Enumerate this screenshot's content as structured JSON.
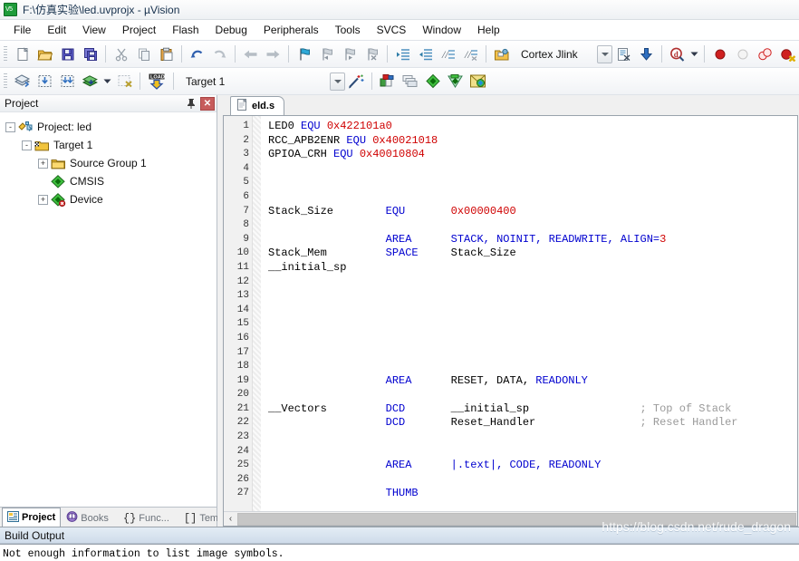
{
  "window": {
    "title": "F:\\仿真实验\\led.uvprojx - µVision",
    "app_icon": "uvision-v5-icon"
  },
  "menubar": {
    "items": [
      "File",
      "Edit",
      "View",
      "Project",
      "Flash",
      "Debug",
      "Peripherals",
      "Tools",
      "SVCS",
      "Window",
      "Help"
    ]
  },
  "toolbar_main": {
    "buttons": [
      {
        "name": "new-file-icon",
        "title": "New"
      },
      {
        "name": "open-file-icon",
        "title": "Open"
      },
      {
        "name": "save-icon",
        "title": "Save"
      },
      {
        "name": "save-all-icon",
        "title": "Save All"
      },
      {
        "name": "cut-icon",
        "title": "Cut"
      },
      {
        "name": "copy-icon",
        "title": "Copy"
      },
      {
        "name": "paste-icon",
        "title": "Paste"
      },
      {
        "name": "undo-icon",
        "title": "Undo"
      },
      {
        "name": "redo-icon",
        "title": "Redo"
      },
      {
        "name": "navigate-back-icon",
        "title": "Back"
      },
      {
        "name": "navigate-forward-icon",
        "title": "Forward"
      },
      {
        "name": "bookmark-toggle-icon",
        "title": "Insert/Remove Bookmark"
      },
      {
        "name": "bookmark-prev-icon",
        "title": "Previous Bookmark"
      },
      {
        "name": "bookmark-next-icon",
        "title": "Next Bookmark"
      },
      {
        "name": "bookmark-clear-icon",
        "title": "Clear All Bookmarks"
      },
      {
        "name": "indent-increase-icon",
        "title": "Indent"
      },
      {
        "name": "indent-decrease-icon",
        "title": "Outdent"
      },
      {
        "name": "comment-icon",
        "title": "Comment"
      },
      {
        "name": "uncomment-icon",
        "title": "Uncomment"
      },
      {
        "name": "target-options-icon",
        "title": "Options for Target"
      }
    ],
    "debugger_combo": {
      "value": "Cortex Jlink"
    },
    "right_buttons": [
      {
        "name": "configure-flash-tools-icon"
      },
      {
        "name": "download-to-flash-icon"
      },
      {
        "name": "start-debug-session-icon"
      },
      {
        "name": "insert-breakpoint-icon"
      },
      {
        "name": "disable-breakpoint-icon"
      },
      {
        "name": "disable-all-breakpoints-icon"
      },
      {
        "name": "kill-all-breakpoints-icon"
      }
    ]
  },
  "toolbar_build": {
    "buttons": [
      {
        "name": "translate-icon",
        "title": "Translate"
      },
      {
        "name": "build-icon",
        "title": "Build"
      },
      {
        "name": "rebuild-icon",
        "title": "Rebuild"
      },
      {
        "name": "batch-build-icon",
        "title": "Batch Build"
      },
      {
        "name": "stop-build-icon",
        "title": "Stop Build"
      },
      {
        "name": "load-icon",
        "title": "Download"
      }
    ],
    "target_combo": {
      "value": "Target 1"
    },
    "right_buttons": [
      {
        "name": "target-options-wand-icon"
      },
      {
        "name": "manage-project-items-icon"
      },
      {
        "name": "multi-project-icon"
      },
      {
        "name": "pack-installer-icon"
      },
      {
        "name": "manage-run-time-env-icon"
      },
      {
        "name": "select-software-packs-icon"
      }
    ]
  },
  "project_panel": {
    "title": "Project",
    "pin_icon": "pin-icon",
    "close_icon": "close-icon",
    "tree": [
      {
        "label": "Project: led",
        "icon": "project-icon",
        "depth": 0,
        "expander": "-"
      },
      {
        "label": "Target 1",
        "icon": "target-folder-icon",
        "depth": 1,
        "expander": "-"
      },
      {
        "label": "Source Group 1",
        "icon": "folder-icon",
        "depth": 2,
        "expander": "+"
      },
      {
        "label": "CMSIS",
        "icon": "component-icon",
        "depth": 2,
        "expander": ""
      },
      {
        "label": "Device",
        "icon": "component-warn-icon",
        "depth": 2,
        "expander": "+"
      }
    ]
  },
  "panel_tabs": [
    {
      "label": "Project",
      "icon": "project-tab-icon",
      "active": true
    },
    {
      "label": "Books",
      "icon": "books-tab-icon",
      "active": false
    },
    {
      "label": "Func...",
      "icon": "functions-tab-icon",
      "active": false
    },
    {
      "label": "Temp...",
      "icon": "templates-tab-icon",
      "active": false
    }
  ],
  "editor": {
    "tabs": [
      {
        "label": "eld.s",
        "icon": "source-file-icon",
        "active": true
      }
    ],
    "first_line": 1,
    "lines": [
      {
        "n": 1,
        "tokens": [
          {
            "t": "LED0 ",
            "c": ""
          },
          {
            "t": "EQU",
            "c": "kw"
          },
          {
            "t": " ",
            "c": ""
          },
          {
            "t": "0x422101a0",
            "c": "num"
          }
        ]
      },
      {
        "n": 2,
        "tokens": [
          {
            "t": "RCC_APB2ENR ",
            "c": ""
          },
          {
            "t": "EQU",
            "c": "kw"
          },
          {
            "t": " ",
            "c": ""
          },
          {
            "t": "0x40021018",
            "c": "num"
          }
        ]
      },
      {
        "n": 3,
        "tokens": [
          {
            "t": "GPIOA_CRH ",
            "c": ""
          },
          {
            "t": "EQU",
            "c": "kw"
          },
          {
            "t": " ",
            "c": ""
          },
          {
            "t": "0x40010804",
            "c": "num"
          }
        ]
      },
      {
        "n": 4,
        "tokens": []
      },
      {
        "n": 5,
        "tokens": []
      },
      {
        "n": 6,
        "tokens": []
      },
      {
        "n": 7,
        "tokens": [
          {
            "t": "Stack_Size        ",
            "c": ""
          },
          {
            "t": "EQU",
            "c": "kw"
          },
          {
            "t": "       ",
            "c": ""
          },
          {
            "t": "0x00000400",
            "c": "num"
          }
        ]
      },
      {
        "n": 8,
        "tokens": []
      },
      {
        "n": 9,
        "tokens": [
          {
            "t": "                  ",
            "c": ""
          },
          {
            "t": "AREA",
            "c": "kw"
          },
          {
            "t": "      ",
            "c": ""
          },
          {
            "t": "STACK, NOINIT, READWRITE, ALIGN=",
            "c": "kw"
          },
          {
            "t": "3",
            "c": "num"
          }
        ]
      },
      {
        "n": 10,
        "tokens": [
          {
            "t": "Stack_Mem         ",
            "c": ""
          },
          {
            "t": "SPACE",
            "c": "kw"
          },
          {
            "t": "     Stack_Size",
            "c": ""
          }
        ]
      },
      {
        "n": 11,
        "tokens": [
          {
            "t": "__initial_sp",
            "c": ""
          }
        ]
      },
      {
        "n": 12,
        "tokens": []
      },
      {
        "n": 13,
        "tokens": []
      },
      {
        "n": 14,
        "tokens": []
      },
      {
        "n": 15,
        "tokens": []
      },
      {
        "n": 16,
        "tokens": []
      },
      {
        "n": 17,
        "tokens": []
      },
      {
        "n": 18,
        "tokens": []
      },
      {
        "n": 19,
        "tokens": [
          {
            "t": "                  ",
            "c": ""
          },
          {
            "t": "AREA",
            "c": "kw"
          },
          {
            "t": "      RESET, DATA, ",
            "c": ""
          },
          {
            "t": "READONLY",
            "c": "kw"
          }
        ]
      },
      {
        "n": 20,
        "tokens": []
      },
      {
        "n": 21,
        "tokens": [
          {
            "t": "__Vectors         ",
            "c": ""
          },
          {
            "t": "DCD",
            "c": "kw"
          },
          {
            "t": "       __initial_sp                 ",
            "c": ""
          },
          {
            "t": "; Top of Stack",
            "c": "cmt"
          }
        ]
      },
      {
        "n": 22,
        "tokens": [
          {
            "t": "                  ",
            "c": ""
          },
          {
            "t": "DCD",
            "c": "kw"
          },
          {
            "t": "       Reset_Handler                ",
            "c": ""
          },
          {
            "t": "; Reset Handler",
            "c": "cmt"
          }
        ]
      },
      {
        "n": 23,
        "tokens": []
      },
      {
        "n": 24,
        "tokens": []
      },
      {
        "n": 25,
        "tokens": [
          {
            "t": "                  ",
            "c": ""
          },
          {
            "t": "AREA",
            "c": "kw"
          },
          {
            "t": "      ",
            "c": ""
          },
          {
            "t": "|.text|, CODE, READONLY",
            "c": "kw"
          }
        ]
      },
      {
        "n": 26,
        "tokens": []
      },
      {
        "n": 27,
        "tokens": [
          {
            "t": "                  ",
            "c": ""
          },
          {
            "t": "THUMB",
            "c": "kw"
          }
        ]
      }
    ],
    "hscroll": {
      "left_arrow": "‹"
    }
  },
  "build_output": {
    "title": "Build Output",
    "text": "Not enough information to list image symbols."
  },
  "watermark": "https://blog.csdn.net/rude_dragon",
  "colors": {
    "keyword": "#0000cf",
    "number": "#cf0000",
    "comment": "#9a9a9a",
    "panel_header": "#cfdcea",
    "close_button": "#c75c5c"
  }
}
